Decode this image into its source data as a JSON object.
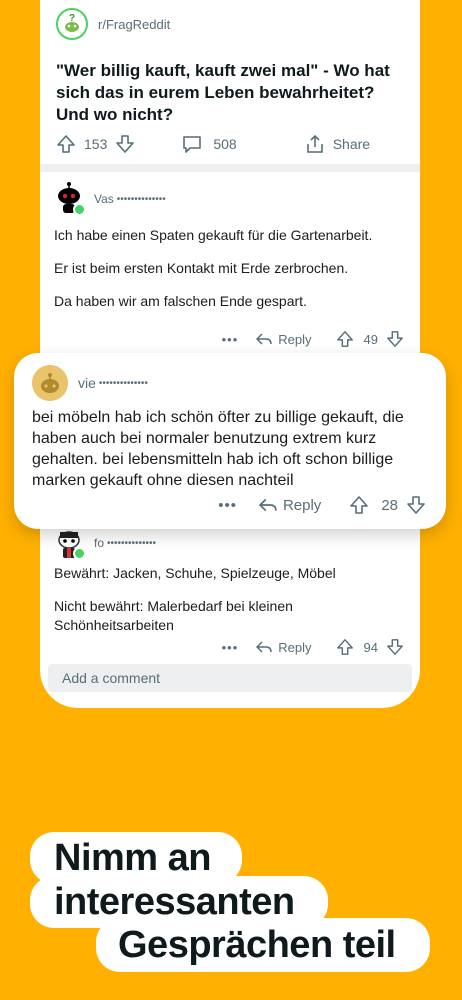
{
  "post": {
    "subreddit": "r/FragReddit",
    "title": "\"Wer billig kauft, kauft zwei mal\" - Wo hat sich das in eurem Leben bewahrheitet? Und wo nicht?",
    "upvotes": "153",
    "comments": "508",
    "share_label": "Share"
  },
  "comments": [
    {
      "user": "Vas",
      "dots": "••••••••••••••",
      "paragraphs": [
        "Ich habe einen Spaten gekauft für die Gartenarbeit.",
        "Er ist beim ersten Kontakt mit Erde zerbrochen.",
        "Da haben wir am falschen Ende gespart."
      ],
      "reply_label": "Reply",
      "votes": "49"
    },
    {
      "user": "vie",
      "dots": "••••••••••••••",
      "paragraphs": [
        "bei möbeln hab ich schön öfter zu billige gekauft, die haben auch bei normaler benutzung extrem kurz gehalten. bei lebensmitteln hab ich oft schon billige marken gekauft ohne diesen nachteil"
      ],
      "reply_label": "Reply",
      "votes": "28"
    },
    {
      "user": "fo",
      "dots": "••••••••••••••",
      "paragraphs": [
        "Bewährt: Jacken, Schuhe, Spielzeuge, Möbel",
        "Nicht bewährt: Malerbedarf bei kleinen Schönheitsarbeiten"
      ],
      "reply_label": "Reply",
      "votes": "94"
    }
  ],
  "add_comment_placeholder": "Add a comment",
  "more_label": "•••",
  "headline": {
    "line1": "Nimm an",
    "line2": "interessanten",
    "line3": "Gesprächen teil"
  },
  "colors": {
    "background": "#FFB000",
    "online": "#46D160"
  }
}
